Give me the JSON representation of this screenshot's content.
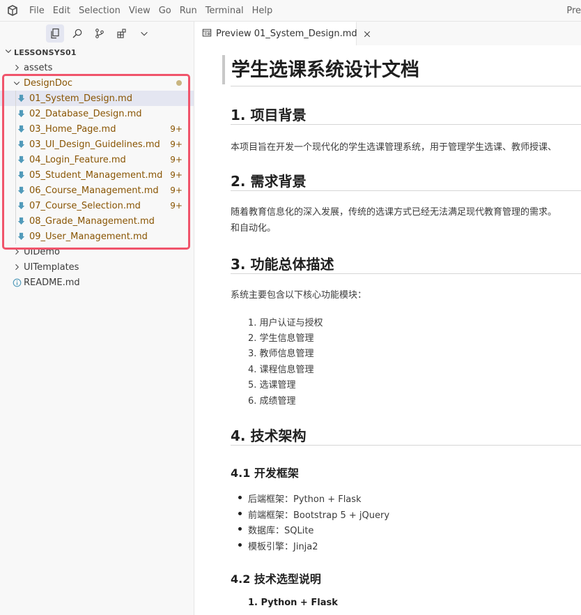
{
  "menu": {
    "items": [
      "File",
      "Edit",
      "Selection",
      "View",
      "Go",
      "Run",
      "Terminal",
      "Help"
    ],
    "right_text": "Pre"
  },
  "sidebar": {
    "toolbar_icons": [
      "files-icon",
      "search-icon",
      "source-control-icon",
      "extensions-icon",
      "chevron-down-icon"
    ],
    "explorer_title": "LESSONSYS01",
    "tree": {
      "assets": "assets",
      "designdoc": "DesignDoc",
      "files": [
        {
          "label": "01_System_Design.md",
          "badge": ""
        },
        {
          "label": "02_Database_Design.md",
          "badge": ""
        },
        {
          "label": "03_Home_Page.md",
          "badge": "9+"
        },
        {
          "label": "03_UI_Design_Guidelines.md",
          "badge": "9+"
        },
        {
          "label": "04_Login_Feature.md",
          "badge": "9+"
        },
        {
          "label": "05_Student_Management.md",
          "badge": "9+"
        },
        {
          "label": "06_Course_Management.md",
          "badge": "9+"
        },
        {
          "label": "07_Course_Selection.md",
          "badge": "9+"
        },
        {
          "label": "08_Grade_Management.md",
          "badge": ""
        },
        {
          "label": "09_User_Management.md",
          "badge": ""
        }
      ],
      "uidemo": "UIDemo",
      "uitemplates": "UITemplates",
      "readme": "README.md"
    }
  },
  "editor": {
    "tab_label": "Preview 01_System_Design.md",
    "doc": {
      "title": "学生选课系统设计文档",
      "h1": "1. 项目背景",
      "p1": "本项目旨在开发一个现代化的学生选课管理系统，用于管理学生选课、教师授课、",
      "h2": "2. 需求背景",
      "p2a": "随着教育信息化的深入发展，传统的选课方式已经无法满足现代教育管理的需求。",
      "p2b": "和自动化。",
      "h3": "3. 功能总体描述",
      "p3": "系统主要包含以下核心功能模块：",
      "modules": [
        "1. 用户认证与授权",
        "2. 学生信息管理",
        "3. 教师信息管理",
        "4. 课程信息管理",
        "5. 选课管理",
        "6. 成绩管理"
      ],
      "h4": "4. 技术架构",
      "h41": "4.1 开发框架",
      "frameworks": [
        "后端框架：Python + Flask",
        "前端框架：Bootstrap 5 + jQuery",
        "数据库：SQLite",
        "模板引擎：Jinja2"
      ],
      "h42": "4.2 技术选型说明",
      "selection_first": "1. Python + Flask"
    }
  },
  "colors": {
    "modified_text": "#895503",
    "highlight_border": "#f0546b",
    "selected_row": "#e4e6f1",
    "md_icon": "#519aba"
  }
}
